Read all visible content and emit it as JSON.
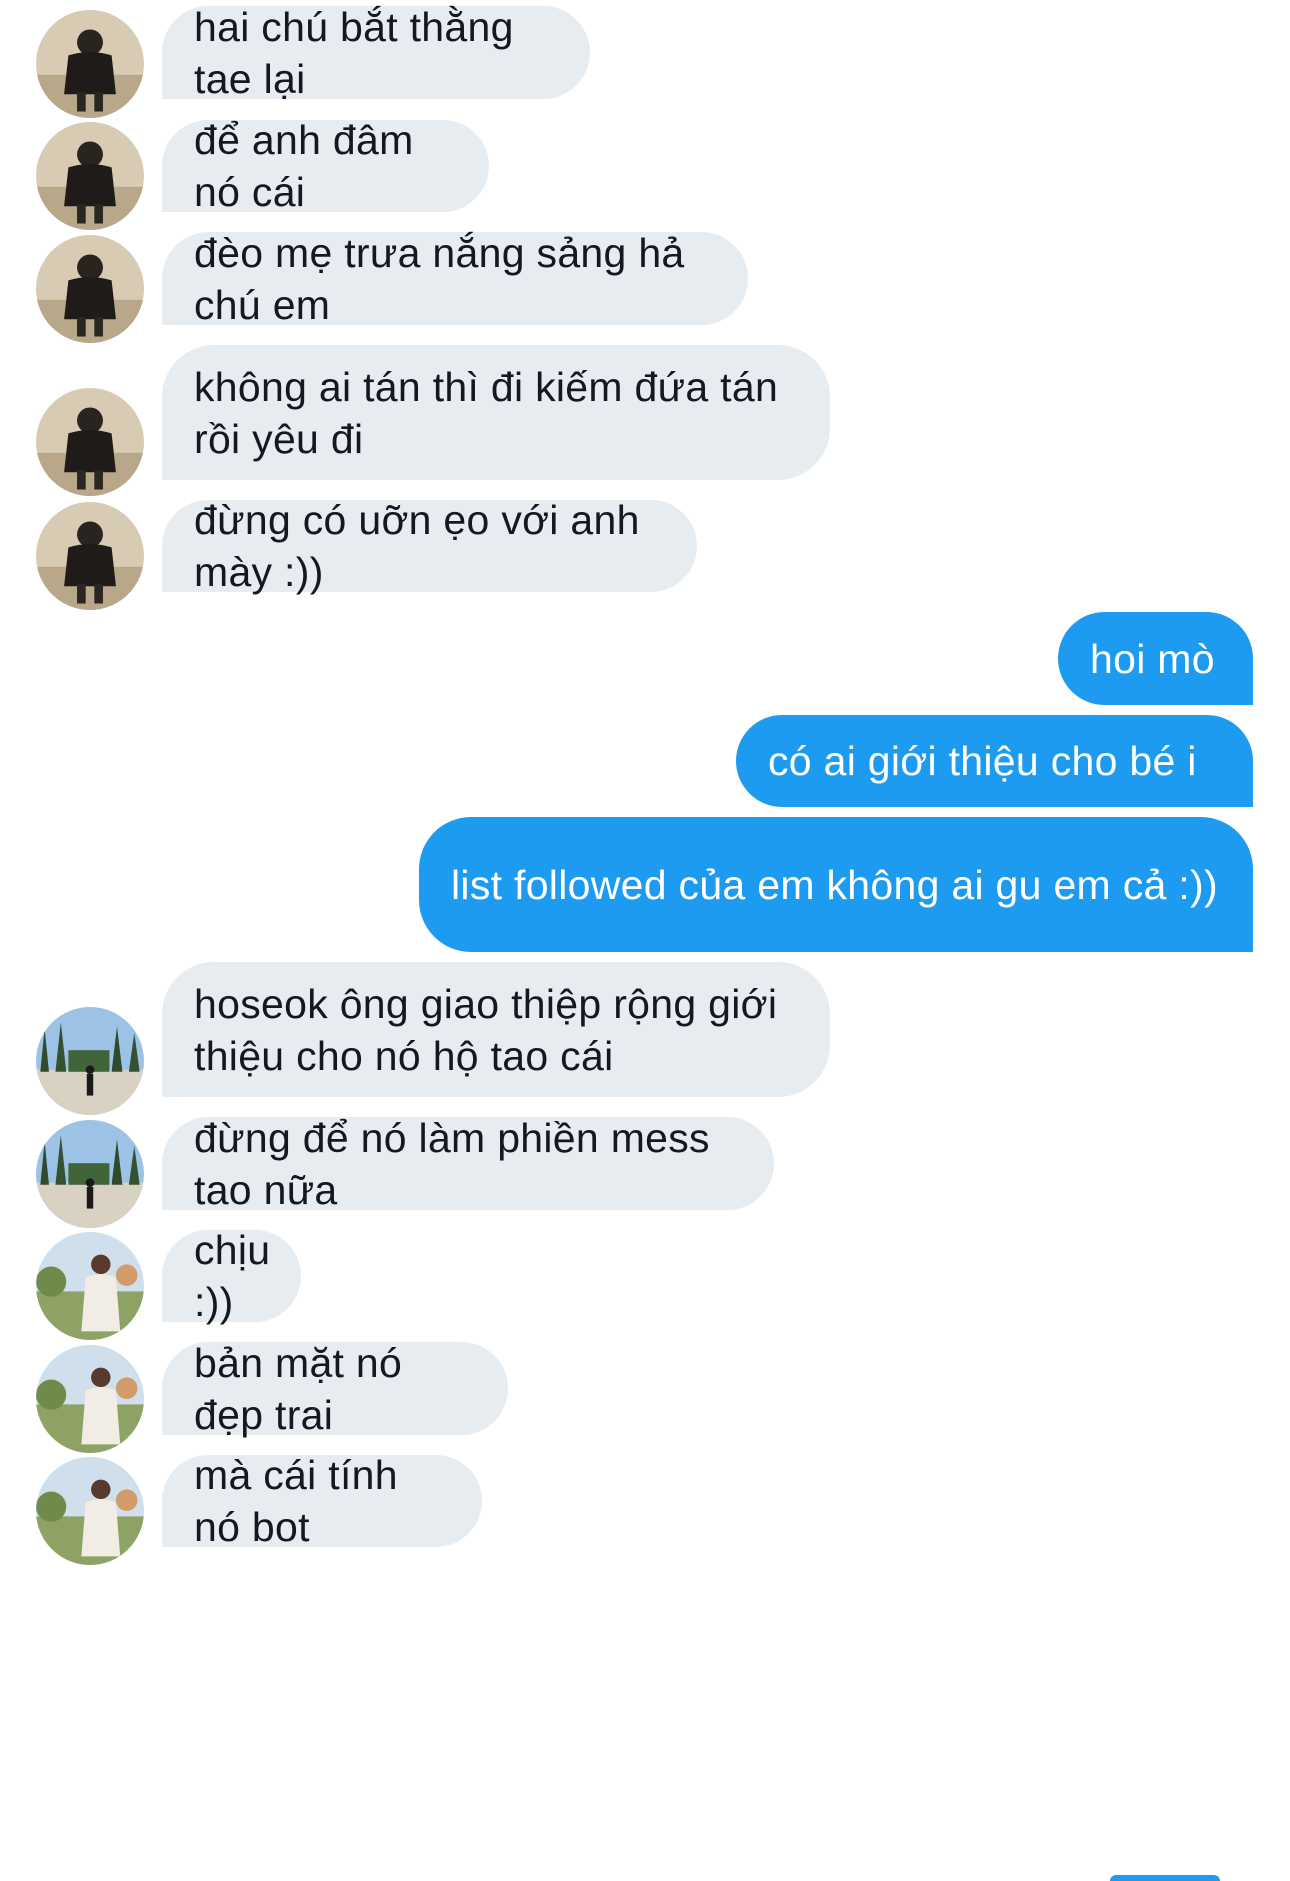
{
  "messages": [
    {
      "dir": "in",
      "avatar": "avatar-a",
      "text": "hai chú bắt thằng tae lại"
    },
    {
      "dir": "in",
      "avatar": "avatar-a",
      "text": "để anh đâm nó cái"
    },
    {
      "dir": "in",
      "avatar": "avatar-a",
      "text": "đèo mẹ trưa nắng sảng hả chú em"
    },
    {
      "dir": "in",
      "avatar": "avatar-a",
      "text": "không ai tán thì đi kiếm đứa tán rồi yêu đi"
    },
    {
      "dir": "in",
      "avatar": "avatar-a",
      "text": "đừng có uỡn ẹo với anh mày :))"
    },
    {
      "dir": "out",
      "text": "hoi mò"
    },
    {
      "dir": "out",
      "text": "có ai giới thiệu cho bé i"
    },
    {
      "dir": "out",
      "text": "list followed của em không ai gu em cả :))"
    },
    {
      "dir": "in",
      "avatar": "avatar-b",
      "text": "hoseok ông giao thiệp rộng giới thiệu cho nó hộ tao cái"
    },
    {
      "dir": "in",
      "avatar": "avatar-b",
      "text": "đừng để nó làm phiền mess tao nữa"
    },
    {
      "dir": "in",
      "avatar": "avatar-c",
      "text": "chịu :))"
    },
    {
      "dir": "in",
      "avatar": "avatar-c",
      "text": "bản mặt nó đẹp trai"
    },
    {
      "dir": "in",
      "avatar": "avatar-c",
      "text": "mà cái tính nó bot"
    }
  ],
  "colors": {
    "incoming_bg": "#e6ecf0",
    "incoming_text": "#141823",
    "outgoing_bg": "#1d9bf0",
    "outgoing_text": "#ffffff"
  }
}
